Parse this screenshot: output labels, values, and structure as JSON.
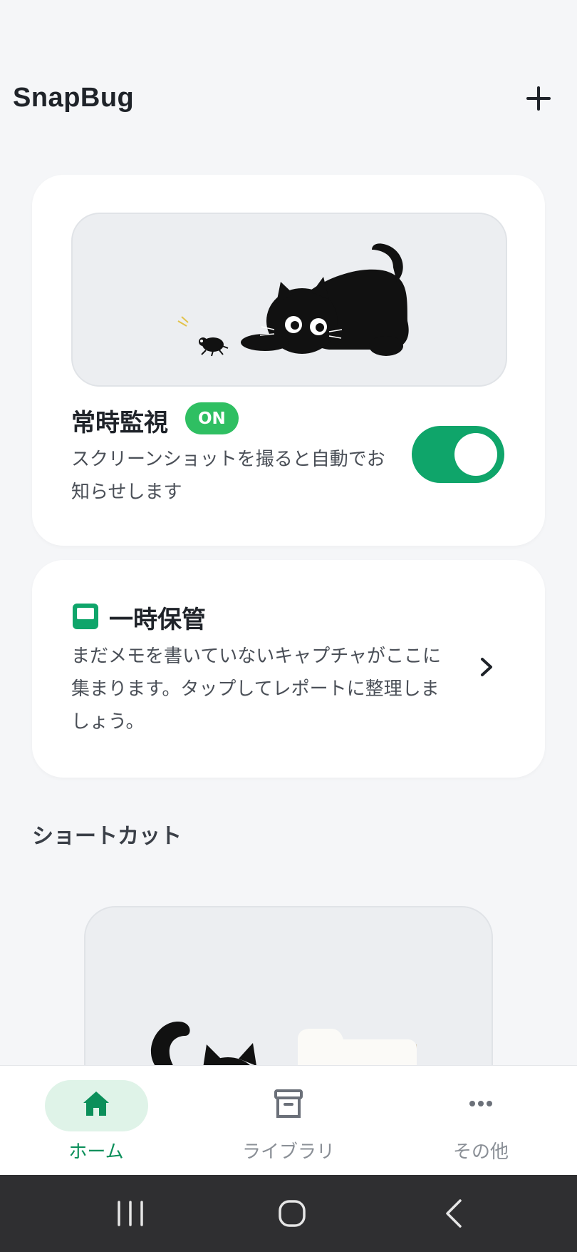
{
  "header": {
    "title": "SnapBug",
    "add_icon": "plus-icon"
  },
  "monitor": {
    "title": "常時監視",
    "badge": "ON",
    "description": "スクリーンショットを撮ると自動でお知らせします",
    "toggle_on": true,
    "accent": "#0fa56a",
    "badge_color": "#2fbf62"
  },
  "temp_storage": {
    "icon": "inbox-icon",
    "title": "一時保管",
    "description": "まだメモを書いていないキャプチャがここに集まります。タップしてレポートに整理しましょう。"
  },
  "shortcuts": {
    "title": "ショートカット"
  },
  "tabbar": {
    "tabs": [
      {
        "label": "ホーム",
        "icon": "home-icon",
        "active": true
      },
      {
        "label": "ライブラリ",
        "icon": "archive-icon",
        "active": false
      },
      {
        "label": "その他",
        "icon": "more-icon",
        "active": false
      }
    ]
  },
  "system_nav": {
    "buttons": [
      "recents-icon",
      "home-circle-icon",
      "back-icon"
    ]
  }
}
